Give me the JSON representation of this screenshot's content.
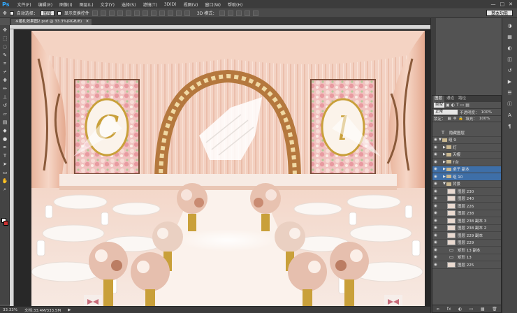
{
  "app": {
    "logo": "Ps"
  },
  "menu": [
    "文件(F)",
    "编辑(E)",
    "图像(I)",
    "图层(L)",
    "文字(Y)",
    "选择(S)",
    "滤镜(T)",
    "3D(D)",
    "视图(V)",
    "窗口(W)",
    "帮助(H)"
  ],
  "window_controls": [
    "—",
    "□",
    "✕"
  ],
  "options": {
    "auto_select_label": "自动选择：",
    "auto_select_value": "图层",
    "show_transform_label": "显示变换控件",
    "mode_3d_label": "3D 模式：",
    "workspace": "基本功能"
  },
  "document": {
    "tab_title": "※婚礼效果图2.psd @ 33.3%(RGB/8)",
    "close": "✕"
  },
  "status": {
    "zoom": "33.33%",
    "doc_size": "文档:33.4M/333.5M"
  },
  "layers_panel": {
    "tabs": [
      "图层",
      "通道",
      "路径"
    ],
    "filter_label": "类型",
    "blend_mode": "正常",
    "opacity_label": "不透明度：",
    "opacity_value": "100%",
    "lock_label": "锁定：",
    "fill_label": "填充：",
    "fill_value": "100%",
    "footer_icons": [
      "∞",
      "fx",
      "◐",
      "▭",
      "▦",
      "🗑"
    ],
    "layers": [
      {
        "name": "隐藏图层",
        "type": "text",
        "level": 0,
        "visible": false,
        "selected": false
      },
      {
        "name": "组 9",
        "type": "group",
        "level": 0,
        "visible": true,
        "expanded": true,
        "selected": false
      },
      {
        "name": "灯",
        "type": "group",
        "level": 1,
        "visible": true,
        "expanded": false,
        "selected": false
      },
      {
        "name": "天幔",
        "type": "group",
        "level": 1,
        "visible": true,
        "expanded": false,
        "selected": false
      },
      {
        "name": "T台",
        "type": "group",
        "level": 1,
        "visible": true,
        "expanded": false,
        "selected": false
      },
      {
        "name": "桌子 副本",
        "type": "group",
        "level": 1,
        "visible": true,
        "expanded": false,
        "selected": true
      },
      {
        "name": "组 10",
        "type": "group",
        "level": 1,
        "visible": true,
        "expanded": false,
        "selected": true
      },
      {
        "name": "背景",
        "type": "group",
        "level": 1,
        "visible": true,
        "expanded": true,
        "selected": false
      },
      {
        "name": "图层 230",
        "type": "pixel",
        "level": 2,
        "visible": true,
        "selected": false
      },
      {
        "name": "图层 240",
        "type": "pixel",
        "level": 2,
        "visible": true,
        "selected": false
      },
      {
        "name": "图层 226",
        "type": "pixel",
        "level": 2,
        "visible": true,
        "selected": false
      },
      {
        "name": "图层 238",
        "type": "pixel",
        "level": 2,
        "visible": true,
        "selected": false
      },
      {
        "name": "图层 238 副本 3",
        "type": "pixel",
        "level": 2,
        "visible": true,
        "selected": false
      },
      {
        "name": "图层 238 副本 2",
        "type": "pixel",
        "level": 2,
        "visible": true,
        "selected": false
      },
      {
        "name": "图层 229 副本",
        "type": "pixel",
        "level": 2,
        "visible": true,
        "selected": false
      },
      {
        "name": "图层 229",
        "type": "pixel",
        "level": 2,
        "visible": true,
        "selected": false
      },
      {
        "name": "矩形 13 副本",
        "type": "shape",
        "level": 2,
        "visible": true,
        "selected": false
      },
      {
        "name": "矩形 13",
        "type": "shape",
        "level": 2,
        "visible": true,
        "selected": false
      },
      {
        "name": "图层 225",
        "type": "pixel",
        "level": 2,
        "visible": true,
        "selected": false
      }
    ]
  },
  "canvas_art": {
    "letter_left": "C",
    "letter_right": "l"
  },
  "colors": {
    "accent_selected": "#3e6fa8",
    "ps_blue": "#31a8ff",
    "drape": "#f1c9b7",
    "gold": "#c9a03a"
  }
}
